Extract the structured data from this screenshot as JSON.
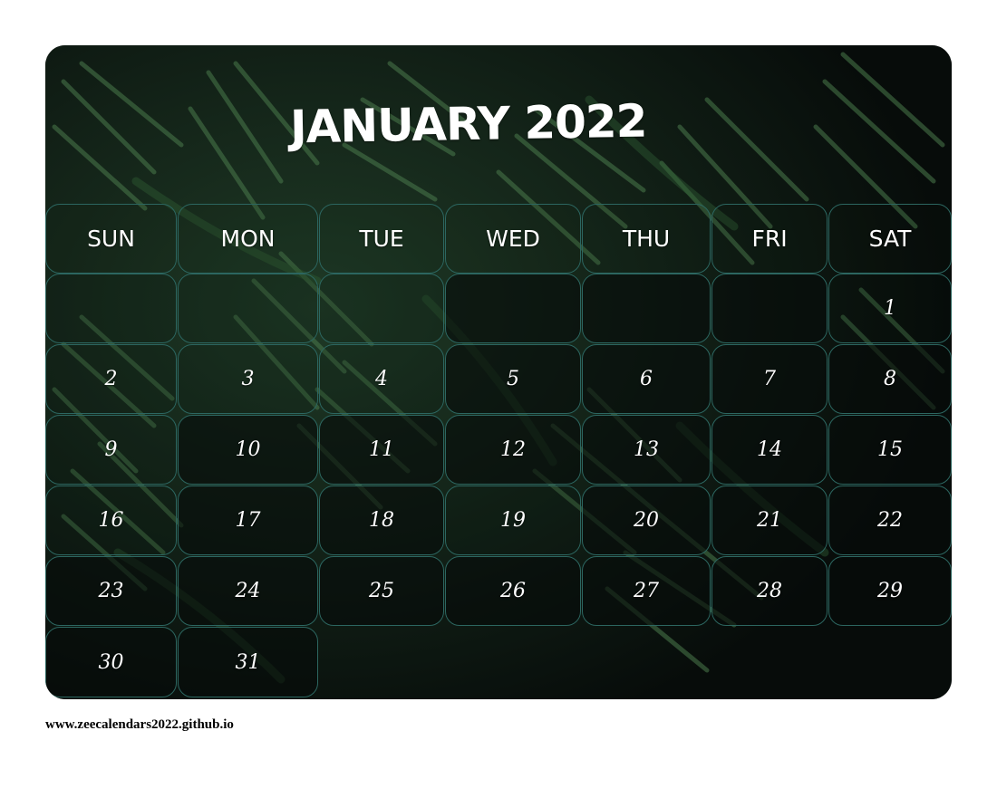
{
  "calendar": {
    "title": "JANUARY 2022",
    "weekdays": [
      "SUN",
      "MON",
      "TUE",
      "WED",
      "THU",
      "FRI",
      "SAT"
    ],
    "days": [
      "1",
      "2",
      "3",
      "4",
      "5",
      "6",
      "7",
      "8",
      "9",
      "10",
      "11",
      "12",
      "13",
      "14",
      "15",
      "16",
      "17",
      "18",
      "19",
      "20",
      "21",
      "22",
      "23",
      "24",
      "25",
      "26",
      "27",
      "28",
      "29",
      "30",
      "31"
    ]
  },
  "footer": {
    "url": "www.zeecalendars2022.github.io"
  },
  "colors": {
    "cell_border": "#2c6660",
    "text": "#ffffff",
    "background": "#0c1210",
    "leaf": "#3c6a40"
  }
}
